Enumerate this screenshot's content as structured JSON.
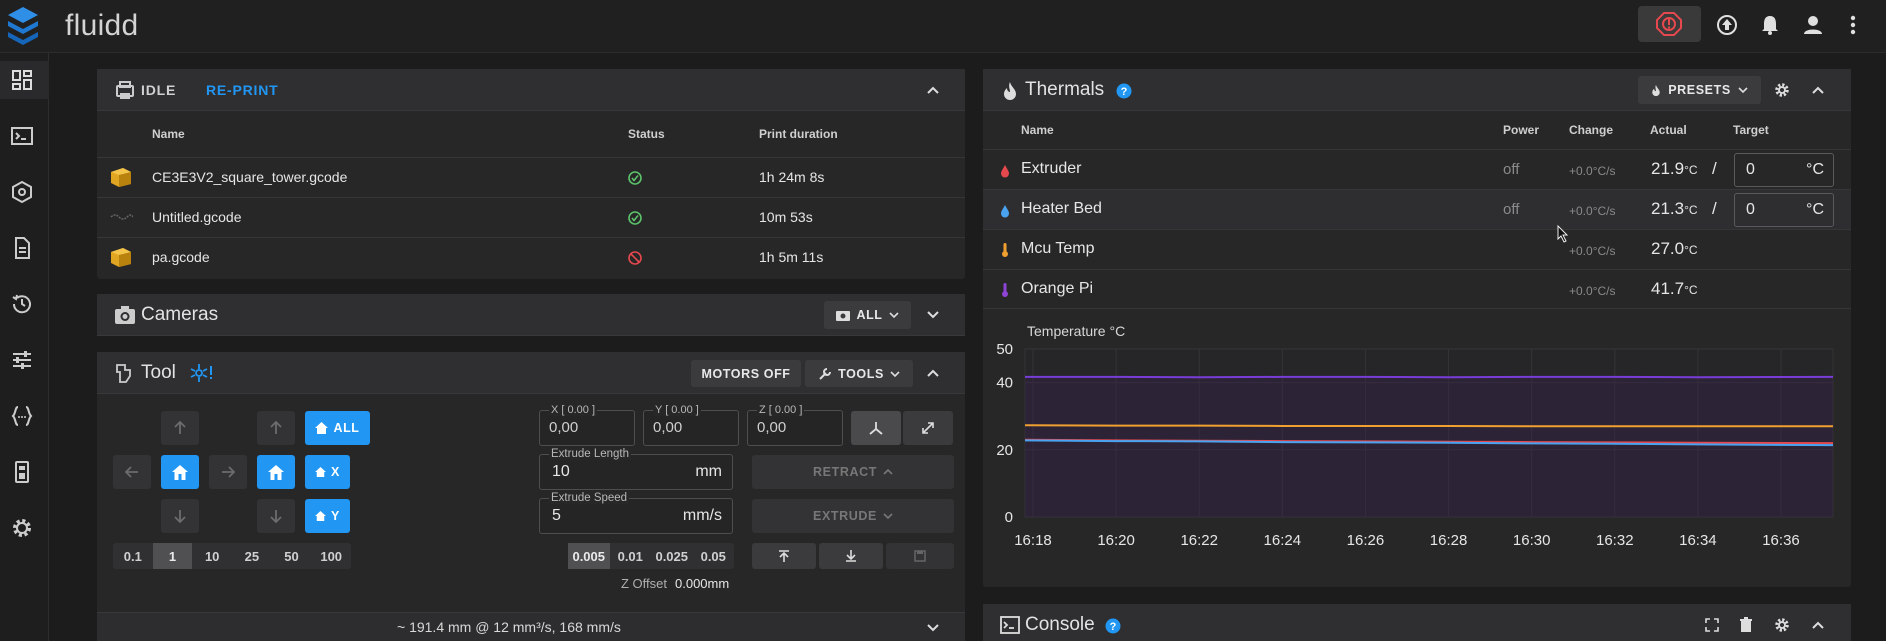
{
  "app": {
    "title": "fluidd"
  },
  "jobs": {
    "status": "IDLE",
    "reprint_label": "RE-PRINT",
    "columns": [
      "Name",
      "Status",
      "Print duration"
    ],
    "rows": [
      {
        "name": "CE3E3V2_square_tower.gcode",
        "status": "ok",
        "duration": "1h 24m 8s"
      },
      {
        "name": "Untitled.gcode",
        "status": "ok",
        "duration": "10m 53s"
      },
      {
        "name": "pa.gcode",
        "status": "cancelled",
        "duration": "1h 5m 11s"
      }
    ]
  },
  "cameras": {
    "title": "Cameras",
    "all_label": "ALL"
  },
  "tool": {
    "title": "Tool",
    "motors_off_label": "MOTORS OFF",
    "tools_label": "TOOLS",
    "home_all_label": "ALL",
    "home_x_label": "X",
    "home_y_label": "Y",
    "distances": [
      "0.1",
      "1",
      "10",
      "25",
      "50",
      "100"
    ],
    "selected_distance": "1",
    "x_label": "X [ 0.00 ]",
    "x_value": "0,00",
    "y_label": "Y [ 0.00 ]",
    "y_value": "0,00",
    "z_label": "Z [ 0.00 ]",
    "z_value": "0,00",
    "extrude_length_label": "Extrude Length",
    "extrude_length_value": "10",
    "extrude_length_unit": "mm",
    "extrude_speed_label": "Extrude Speed",
    "extrude_speed_value": "5",
    "extrude_speed_unit": "mm/s",
    "retract_label": "RETRACT",
    "extrude_label": "EXTRUDE",
    "z_steps": [
      "0.005",
      "0.01",
      "0.025",
      "0.05"
    ],
    "selected_z_step": "0.005",
    "z_offset_label": "Z Offset",
    "z_offset_value": "0.000mm",
    "flow_summary": "~ 191.4 mm @ 12 mm³/s, 168 mm/s"
  },
  "thermals": {
    "title": "Thermals",
    "presets_label": "PRESETS",
    "columns": [
      "Name",
      "Power",
      "Change",
      "Actual",
      "Target"
    ],
    "rows": [
      {
        "name": "Extruder",
        "power": "off",
        "change": "+0.0°C/s",
        "actual": "21.9",
        "unit": "°C",
        "target": "0",
        "target_unit": "°C",
        "color": "#e5484d"
      },
      {
        "name": "Heater Bed",
        "power": "off",
        "change": "+0.0°C/s",
        "actual": "21.3",
        "unit": "°C",
        "target": "0",
        "target_unit": "°C",
        "color": "#4aa3f0"
      },
      {
        "name": "Mcu Temp",
        "power": "",
        "change": "+0.0°C/s",
        "actual": "27.0",
        "unit": "°C",
        "color": "#f0a030"
      },
      {
        "name": "Orange Pi",
        "power": "",
        "change": "+0.0°C/s",
        "actual": "41.7",
        "unit": "°C",
        "color": "#8e44d6"
      }
    ]
  },
  "console": {
    "title": "Console"
  },
  "chart_data": {
    "type": "line",
    "title": "Temperature °C",
    "x": [
      "16:18",
      "16:20",
      "16:22",
      "16:24",
      "16:26",
      "16:28",
      "16:30",
      "16:32",
      "16:34",
      "16:36"
    ],
    "ylim": [
      0,
      50
    ],
    "yticks": [
      0,
      20,
      40,
      50
    ],
    "series": [
      {
        "name": "Orange Pi",
        "color": "#7a3cd8",
        "values": [
          41.7,
          41.7,
          41.6,
          41.7,
          41.7,
          41.6,
          41.7,
          41.7,
          41.6,
          41.7
        ]
      },
      {
        "name": "Mcu Temp",
        "color": "#f0a030",
        "values": [
          27.3,
          27.2,
          27.2,
          27.1,
          27.1,
          27.1,
          27.0,
          27.0,
          27.0,
          27.0
        ]
      },
      {
        "name": "Extruder",
        "color": "#e5484d",
        "values": [
          23.0,
          22.8,
          22.7,
          22.6,
          22.5,
          22.4,
          22.3,
          22.2,
          22.1,
          22.0
        ]
      },
      {
        "name": "Heater Bed",
        "color": "#4aa3f0",
        "values": [
          22.8,
          22.6,
          22.5,
          22.3,
          22.2,
          22.1,
          21.9,
          21.8,
          21.6,
          21.4
        ]
      }
    ],
    "grid": true
  }
}
